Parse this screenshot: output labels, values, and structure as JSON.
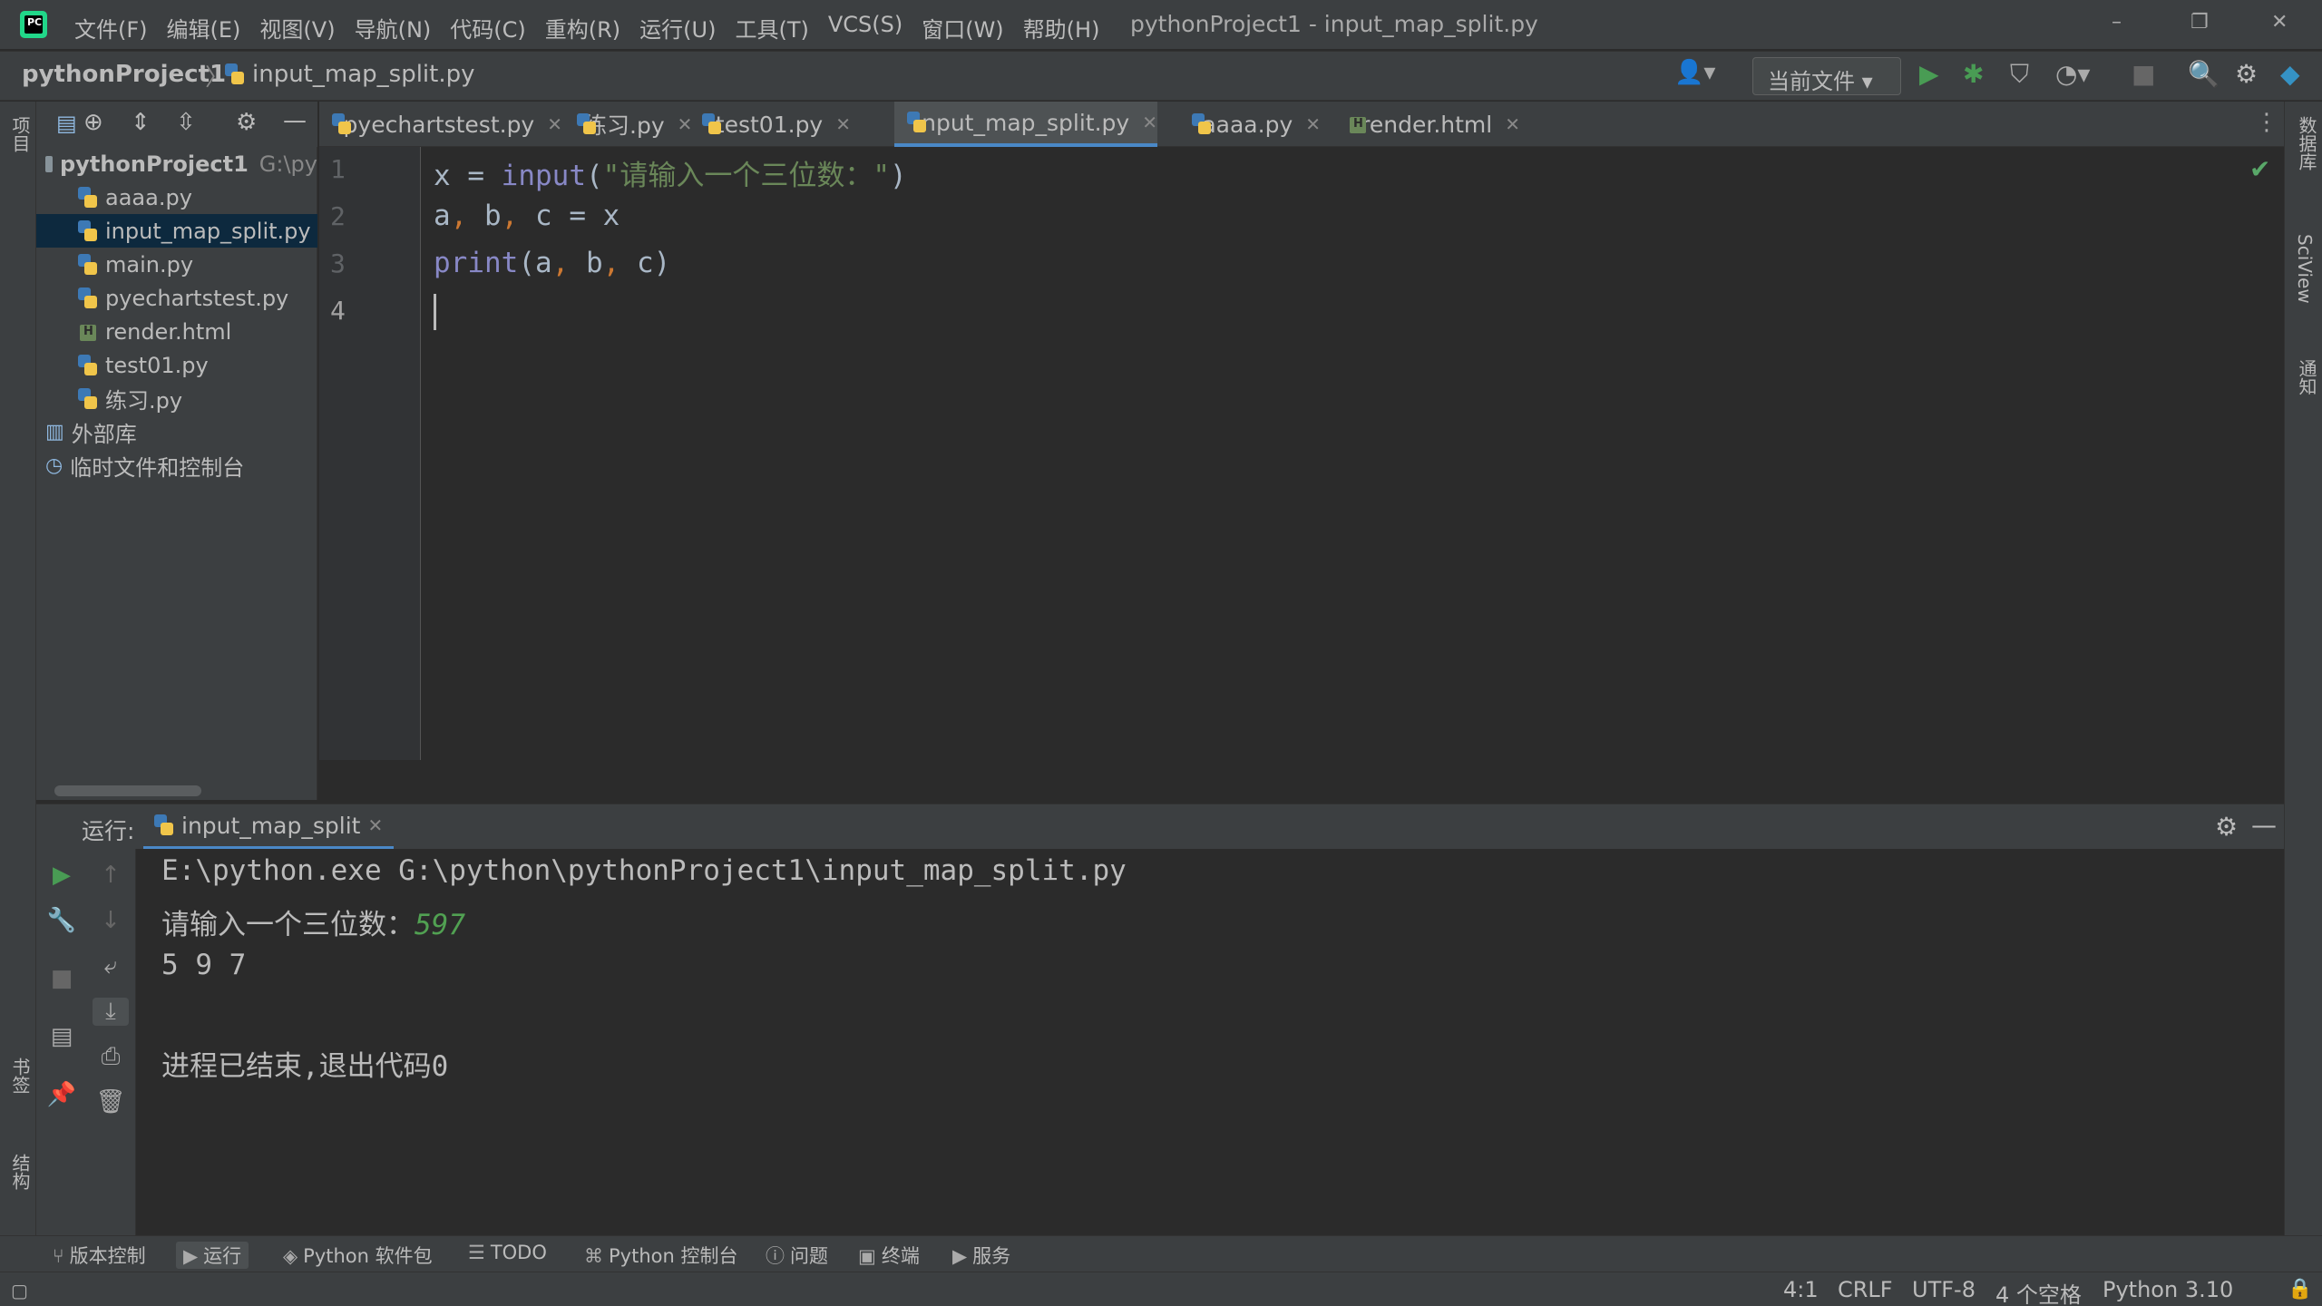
{
  "title_bar": {
    "logo_text": "PC",
    "menu": [
      "文件(F)",
      "编辑(E)",
      "视图(V)",
      "导航(N)",
      "代码(C)",
      "重构(R)",
      "运行(U)",
      "工具(T)",
      "VCS(S)",
      "窗口(W)",
      "帮助(H)"
    ],
    "window_title": "pythonProject1 - input_map_split.py",
    "buttons": {
      "minimize": "–",
      "restore": "❐",
      "close": "✕"
    }
  },
  "nav_bar": {
    "project": "pythonProject1",
    "separator": "〉",
    "file": "input_map_split.py",
    "run_config": "当前文件 ▾"
  },
  "left_strip": {
    "project_label": "项目",
    "bookmarks_label": "书签",
    "structure_label": "结构"
  },
  "right_strip": {
    "database_label": "数据库",
    "sciview_label": "SciView",
    "notifications_label": "通知"
  },
  "project_tree": {
    "root": {
      "name": "pythonProject1",
      "path": "G:\\py"
    },
    "files": [
      {
        "name": "aaaa.py",
        "type": "python"
      },
      {
        "name": "input_map_split.py",
        "type": "python",
        "selected": true
      },
      {
        "name": "main.py",
        "type": "python"
      },
      {
        "name": "pyechartstest.py",
        "type": "python"
      },
      {
        "name": "render.html",
        "type": "html"
      },
      {
        "name": "test01.py",
        "type": "python"
      },
      {
        "name": "练习.py",
        "type": "python"
      }
    ],
    "external_libs": "外部库",
    "scratches": "临时文件和控制台"
  },
  "tabs": [
    {
      "label": "pyechartstest.py",
      "type": "python"
    },
    {
      "label": "练习.py",
      "type": "python"
    },
    {
      "label": "test01.py",
      "type": "python"
    },
    {
      "label": "input_map_split.py",
      "type": "python",
      "active": true
    },
    {
      "label": "aaaa.py",
      "type": "python"
    },
    {
      "label": "render.html",
      "type": "html"
    }
  ],
  "editor": {
    "line_numbers": [
      "1",
      "2",
      "3",
      "4"
    ],
    "line1": {
      "var": "x",
      "eq": " = ",
      "fn": "input",
      "open": "(",
      "str": "\"请输入一个三位数：\"",
      "close": ")"
    },
    "line2": {
      "a": "a",
      "c1": ",",
      "b": " b",
      "c2": ",",
      "rest": " c = x"
    },
    "line3": {
      "fn": "print",
      "open": "(a",
      "c1": ",",
      "b": " b",
      "c2": ",",
      "rest": " c)"
    }
  },
  "run_panel": {
    "label": "运行:",
    "tab": "input_map_split",
    "command": "E:\\python.exe G:\\python\\pythonProject1\\input_map_split.py",
    "prompt": "请输入一个三位数：",
    "user_input": "597",
    "output": "5 9 7",
    "exit_message": "进程已结束,退出代码0"
  },
  "bottom_tools": [
    "版本控制",
    "运行",
    "Python 软件包",
    "TODO",
    "Python 控制台",
    "问题",
    "终端",
    "服务"
  ],
  "status_bar": {
    "position": "4:1",
    "line_sep": "CRLF",
    "encoding": "UTF-8",
    "indent": "4 个空格",
    "interpreter": "Python 3.10"
  }
}
